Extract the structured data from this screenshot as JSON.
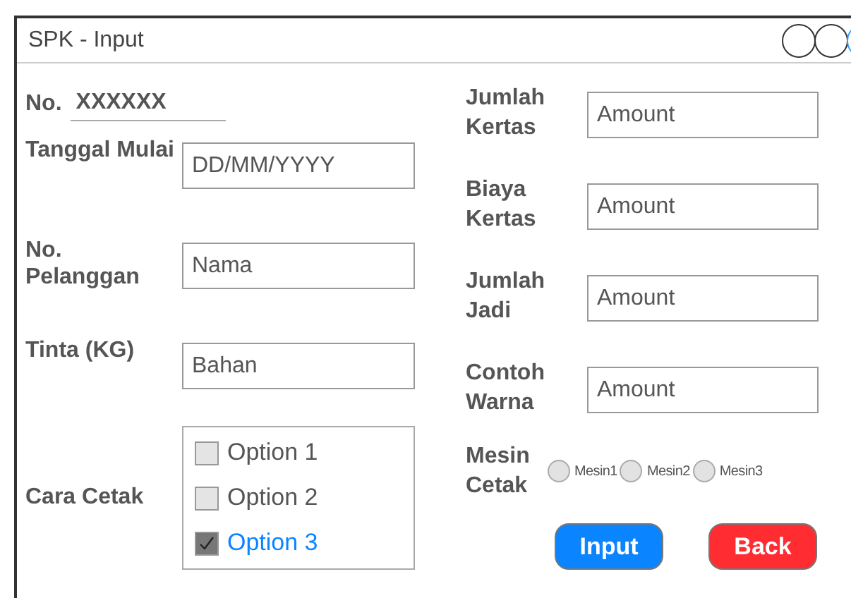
{
  "window": {
    "title": "SPK - Input"
  },
  "number": {
    "label": "No.",
    "value": "XXXXXX"
  },
  "left_fields": [
    {
      "label": "Tanggal Mulai",
      "placeholder": "DD/MM/YYYY"
    },
    {
      "label": "No. Pelanggan",
      "placeholder": "Nama"
    },
    {
      "label": "Tinta (KG)",
      "placeholder": "Bahan"
    }
  ],
  "cara_cetak": {
    "label": "Cara Cetak",
    "options": [
      {
        "label": "Option 1",
        "checked": false
      },
      {
        "label": "Option 2",
        "checked": false
      },
      {
        "label": "Option 3",
        "checked": true
      }
    ]
  },
  "right_fields": [
    {
      "label": "Jumlah Kertas",
      "placeholder": "Amount"
    },
    {
      "label": "Biaya Kertas",
      "placeholder": "Amount"
    },
    {
      "label": "Jumlah Jadi",
      "placeholder": "Amount"
    },
    {
      "label": "Contoh Warna",
      "placeholder": "Amount"
    }
  ],
  "mesin_cetak": {
    "label": "Mesin Cetak",
    "options": [
      {
        "label": "Mesin1",
        "selected": false
      },
      {
        "label": "Mesin2",
        "selected": false
      },
      {
        "label": "Mesin3",
        "selected": false
      }
    ]
  },
  "buttons": [
    {
      "label": "Input",
      "kind": "primary"
    },
    {
      "label": "Back",
      "kind": "danger"
    }
  ]
}
